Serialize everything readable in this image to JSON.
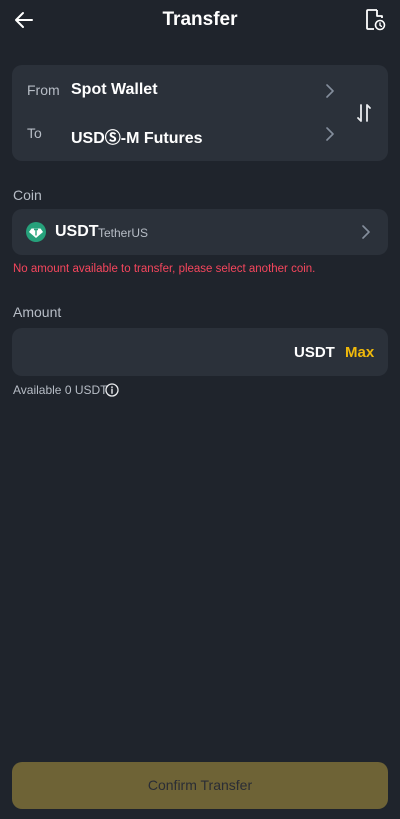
{
  "header": {
    "title": "Transfer",
    "back_icon": "back-arrow-icon",
    "history_icon": "history-icon"
  },
  "transfer": {
    "from_label": "From",
    "from_value": "Spot Wallet",
    "to_label": "To",
    "to_value": "USDⓈ-M Futures",
    "swap_icon": "swap-icon"
  },
  "coin": {
    "label": "Coin",
    "symbol": "USDT",
    "name": "TetherUS",
    "icon": "tether-icon",
    "icon_color": "#26a17b"
  },
  "error": {
    "message": "No amount available to transfer, please select another coin.",
    "color": "#f6465d"
  },
  "amount": {
    "label": "Amount",
    "value": "",
    "unit": "USDT",
    "max_label": "Max",
    "max_color": "#f0b90b",
    "available_text": "Available 0 USDT"
  },
  "confirm": {
    "label": "Confirm Transfer",
    "color": "#6e6336"
  }
}
